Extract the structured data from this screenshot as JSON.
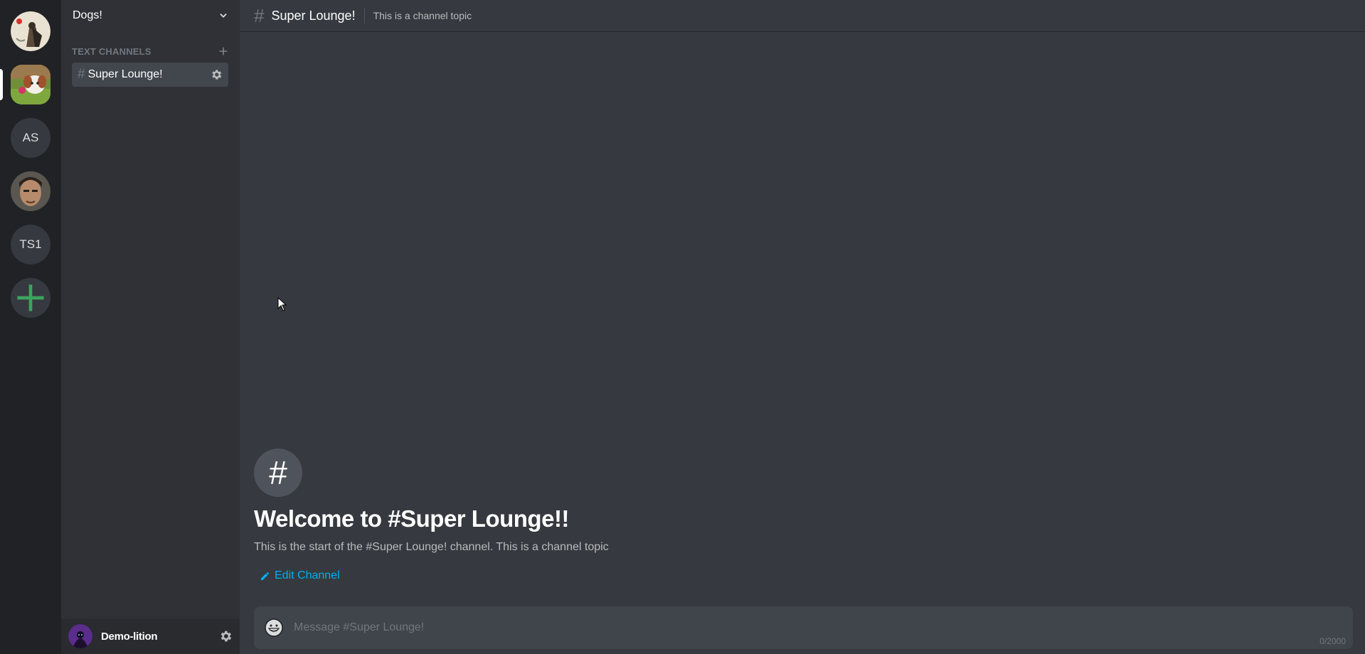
{
  "servers": [
    {
      "name": "server-1",
      "type": "image"
    },
    {
      "name": "server-2",
      "type": "image",
      "active": true
    },
    {
      "initials": "AS"
    },
    {
      "name": "server-4",
      "type": "image"
    },
    {
      "initials": "TS1"
    },
    {
      "icon": "plus-icon"
    }
  ],
  "guild": {
    "name": "Dogs!",
    "menu_icon": "chevron-down-icon"
  },
  "categories": [
    {
      "label": "TEXT CHANNELS",
      "add_icon": "plus-icon"
    }
  ],
  "channels": [
    {
      "hash": "#",
      "name": "Super Lounge!",
      "settings_icon": "gear-icon"
    }
  ],
  "user": {
    "name": "Demo-lition",
    "settings_icon": "gear-icon"
  },
  "header": {
    "hash": "#",
    "channel_name": "Super Lounge!",
    "topic": "This is a channel topic"
  },
  "welcome": {
    "hash": "#",
    "title": "Welcome to #Super Lounge!!",
    "subtitle": "This is the start of the #Super Lounge! channel. This is a channel topic",
    "edit_label": "Edit Channel"
  },
  "composer": {
    "placeholder": "Message #Super Lounge!",
    "counter": "0/2000",
    "emoji_icon": "grinning-face-icon"
  },
  "colors": {
    "rail": "#202225",
    "sidebar": "#2f3136",
    "main": "#36393f",
    "selected_channel": "#42464d",
    "link": "#00b0f4",
    "add_server": "#3ba55c"
  }
}
